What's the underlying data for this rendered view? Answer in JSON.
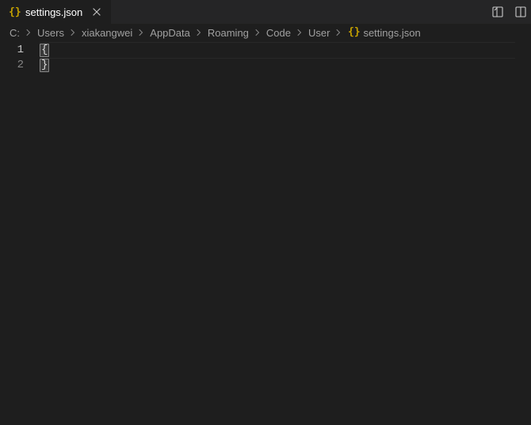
{
  "tab": {
    "label": "settings.json",
    "icon": "json-icon"
  },
  "breadcrumb": {
    "items": [
      {
        "label": "C:"
      },
      {
        "label": "Users"
      },
      {
        "label": "xiakangwei"
      },
      {
        "label": "AppData"
      },
      {
        "label": "Roaming"
      },
      {
        "label": "Code"
      },
      {
        "label": "User"
      },
      {
        "label": "settings.json",
        "icon": "json-icon"
      }
    ]
  },
  "editor": {
    "lines": [
      {
        "number": "1",
        "text": "{",
        "active": true
      },
      {
        "number": "2",
        "text": "}",
        "active": false
      }
    ]
  }
}
